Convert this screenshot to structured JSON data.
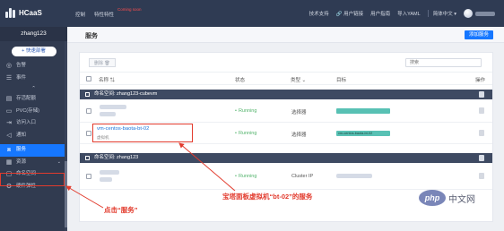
{
  "topbar": {
    "brand": "HCaaS",
    "nav": [
      "控制",
      "特性特性"
    ],
    "nav_hint": "Coming soon",
    "right": [
      "技术支持",
      "用户链接",
      "用户指南",
      "导入YAML",
      "简体中文"
    ]
  },
  "sidebar": {
    "user": "zhang123",
    "quick_deploy": "+ 快速部署",
    "items": [
      {
        "label": "告警",
        "icon": "alarm-icon"
      },
      {
        "label": "事件",
        "icon": "list-icon"
      },
      {
        "label": "存活配额",
        "icon": "quota-icon"
      },
      {
        "label": "PVC(存储)",
        "icon": "storage-icon"
      },
      {
        "label": "访问入口",
        "icon": "entry-icon"
      },
      {
        "label": "通知",
        "icon": "notify-icon"
      },
      {
        "label": "服务",
        "icon": "service-icon"
      },
      {
        "label": "资源",
        "icon": "resource-icon"
      },
      {
        "label": "命名空间",
        "icon": "namespace-icon"
      },
      {
        "label": "硬件弹性",
        "icon": "hardware-icon"
      }
    ]
  },
  "main": {
    "title": "服务",
    "add_button": "添加服务",
    "delete_button": "删除",
    "search_placeholder": "搜索",
    "columns": [
      "名称",
      "状态",
      "类型",
      "目标",
      "操作"
    ],
    "groups": [
      {
        "label": "命名空间: zhang123-cubevm",
        "rows": [
          {
            "name": "",
            "status": "Running",
            "type": "选择器",
            "target": ""
          },
          {
            "name": "vm-centos-baota-bt-02",
            "sub": "虚拟机",
            "status": "Running",
            "type": "选择器",
            "target": "vm-centos-baota-bt-02"
          }
        ]
      },
      {
        "label": "命名空间: zhang123",
        "rows": [
          {
            "name": "",
            "status": "Running",
            "type": "Cluster IP",
            "target": ""
          }
        ]
      }
    ]
  },
  "annotations": {
    "click_service": "点击“服务”",
    "bt_service": "宝塔面板虚拟机“bt-02”的服务"
  },
  "watermark": {
    "logo": "php",
    "text": "中文网"
  },
  "colors": {
    "topbar": "#2f3b53",
    "sidebar": "#313b50",
    "accent": "#1677ff",
    "annotation": "#e23b2d",
    "running": "#52b36b"
  }
}
